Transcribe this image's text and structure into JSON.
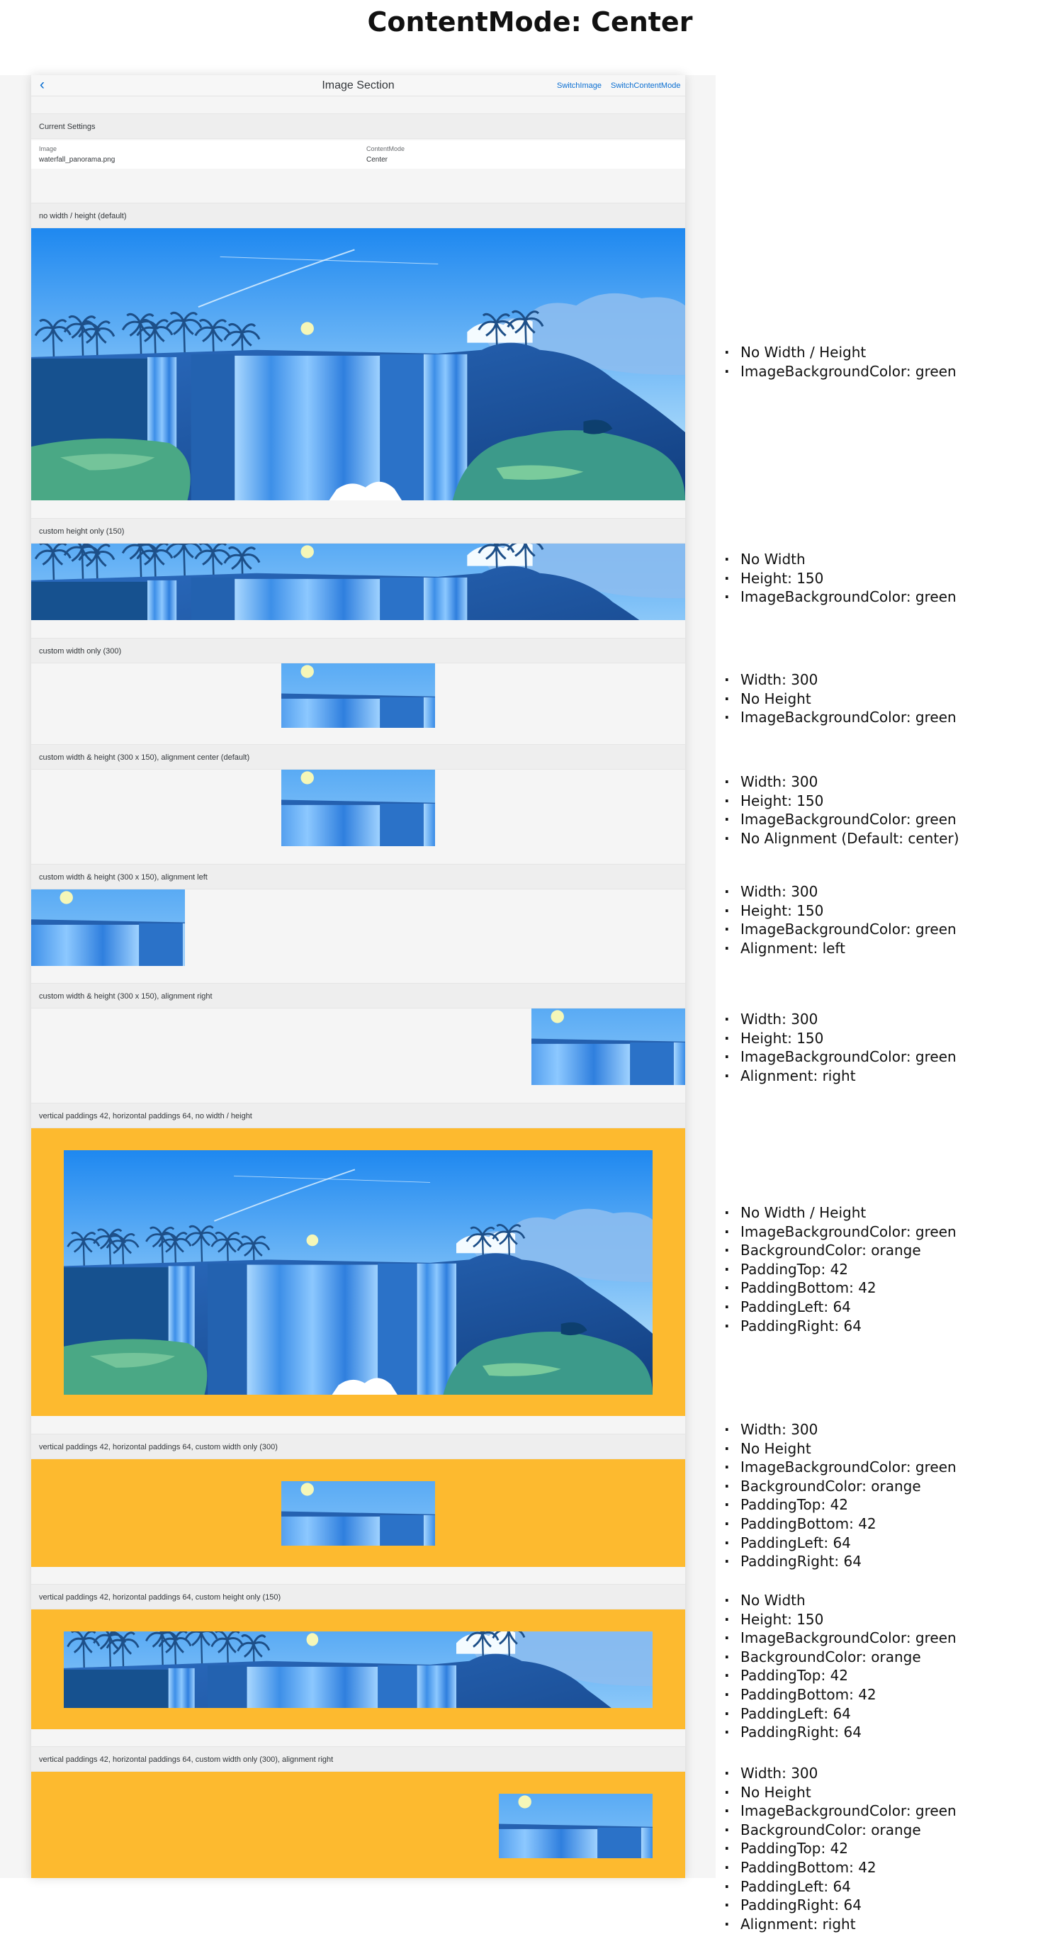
{
  "page": {
    "heading": "ContentMode: Center"
  },
  "nav": {
    "back_icon": "chevron-left-icon",
    "title": "Image Section",
    "actions": [
      "SwitchImage",
      "SwitchContentMode"
    ]
  },
  "settings": {
    "header": "Current Settings",
    "image_label": "Image",
    "image_value": "waterfall_panorama.png",
    "mode_label": "ContentMode",
    "mode_value": "Center"
  },
  "sections": [
    {
      "title": "no width / height (default)"
    },
    {
      "title": "custom height only (150)"
    },
    {
      "title": "custom width only (300)"
    },
    {
      "title": "custom width & height (300 x 150), alignment center (default)"
    },
    {
      "title": "custom width & height (300 x 150), alignment left"
    },
    {
      "title": "custom width & height (300 x 150), alignment right"
    },
    {
      "title": "vertical paddings 42, horizontal paddings 64, no width / height"
    },
    {
      "title": "vertical paddings 42, horizontal paddings 64, custom width only (300)"
    },
    {
      "title": "vertical paddings 42, horizontal paddings 64, custom height only (150)"
    },
    {
      "title": "vertical paddings 42, horizontal paddings 64, custom width only (300), alignment right"
    }
  ],
  "notes": [
    [
      "No Width / Height",
      "ImageBackgroundColor: green"
    ],
    [
      "No Width",
      "Height: 150",
      "ImageBackgroundColor: green"
    ],
    [
      "Width: 300",
      "No Height",
      "ImageBackgroundColor: green"
    ],
    [
      "Width: 300",
      "Height: 150",
      "ImageBackgroundColor: green",
      "No Alignment (Default: center)"
    ],
    [
      "Width: 300",
      "Height: 150",
      "ImageBackgroundColor: green",
      "Alignment: left"
    ],
    [
      "Width: 300",
      "Height: 150",
      "ImageBackgroundColor: green",
      "Alignment: right"
    ],
    [
      "No Width / Height",
      "ImageBackgroundColor: green",
      "BackgroundColor: orange",
      "PaddingTop: 42",
      "PaddingBottom: 42",
      "PaddingLeft: 64",
      "PaddingRight: 64"
    ],
    [
      "Width: 300",
      "No Height",
      "ImageBackgroundColor: green",
      "BackgroundColor: orange",
      "PaddingTop: 42",
      "PaddingBottom: 42",
      "PaddingLeft: 64",
      "PaddingRight: 64"
    ],
    [
      "No Width",
      "Height: 150",
      "ImageBackgroundColor: green",
      "BackgroundColor: orange",
      "PaddingTop: 42",
      "PaddingBottom: 42",
      "PaddingLeft: 64",
      "PaddingRight: 64"
    ],
    [
      "Width: 300",
      "No Height",
      "ImageBackgroundColor: green",
      "BackgroundColor: orange",
      "PaddingTop: 42",
      "PaddingBottom: 42",
      "PaddingLeft: 64",
      "PaddingRight: 64",
      "Alignment: right"
    ]
  ],
  "colors": {
    "accent": "#0a6ed1",
    "padding_background": "#fdba2f",
    "sky_top": "#1e88f0",
    "sky_bottom": "#cdeefd",
    "cliff": "#1a5aa6",
    "waterfall": "#5aaaf5",
    "grass": "#4aa885"
  }
}
